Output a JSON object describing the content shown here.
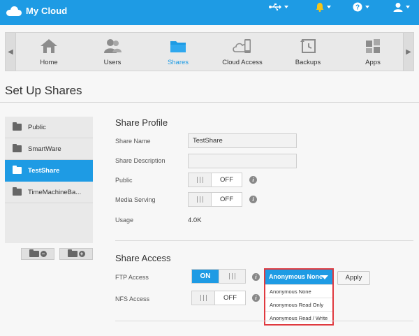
{
  "app": {
    "brand": "My Cloud"
  },
  "topbar": {
    "icons": [
      {
        "name": "usb-icon",
        "glyph": "⭿"
      },
      {
        "name": "bell-icon",
        "glyph": "🔔"
      },
      {
        "name": "help-icon",
        "glyph": "?"
      },
      {
        "name": "user-icon",
        "glyph": "👤"
      }
    ]
  },
  "nav": {
    "items": [
      {
        "label": "Home",
        "icon": "home-icon"
      },
      {
        "label": "Users",
        "icon": "users-icon"
      },
      {
        "label": "Shares",
        "icon": "shares-folder-icon",
        "active": true
      },
      {
        "label": "Cloud Access",
        "icon": "cloud-access-icon"
      },
      {
        "label": "Backups",
        "icon": "backups-icon"
      },
      {
        "label": "Apps",
        "icon": "apps-icon"
      }
    ]
  },
  "page": {
    "title": "Set Up Shares"
  },
  "shares": {
    "items": [
      {
        "label": "Public"
      },
      {
        "label": "SmartWare"
      },
      {
        "label": "TestShare",
        "active": true
      },
      {
        "label": "TimeMachineBa..."
      }
    ]
  },
  "profile": {
    "title": "Share Profile",
    "share_name_label": "Share Name",
    "share_name_value": "TestShare",
    "share_desc_label": "Share Description",
    "share_desc_value": "",
    "public_label": "Public",
    "public_state": "OFF",
    "media_label": "Media Serving",
    "media_state": "OFF",
    "usage_label": "Usage",
    "usage_value": "4.0K"
  },
  "access": {
    "title": "Share Access",
    "ftp_label": "FTP Access",
    "ftp_state": "ON",
    "nfs_label": "NFS Access",
    "nfs_state": "OFF",
    "dropdown": {
      "selected": "Anonymous None",
      "options": [
        "Anonymous None",
        "Anonymous Read Only",
        "Anonymous Read / Write"
      ]
    },
    "apply_label": "Apply"
  },
  "colors": {
    "accent": "#1e9be4",
    "highlight_border": "#e0393f"
  }
}
